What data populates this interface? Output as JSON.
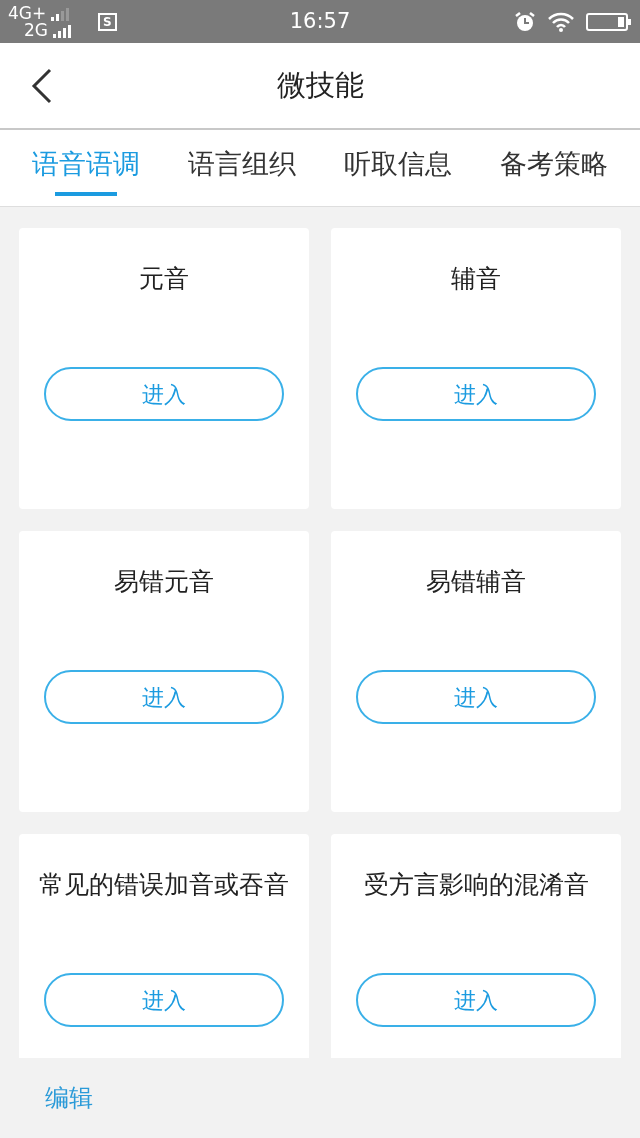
{
  "status_bar": {
    "network_1": "4G+",
    "network_2": "2G",
    "app_badge": "S",
    "time": "16:57"
  },
  "header": {
    "title": "微技能"
  },
  "tabs": [
    {
      "label": "语音语调",
      "selected": true
    },
    {
      "label": "语言组织",
      "selected": false
    },
    {
      "label": "听取信息",
      "selected": false
    },
    {
      "label": "备考策略",
      "selected": false
    }
  ],
  "cards": [
    {
      "title": "元音",
      "button": "进入"
    },
    {
      "title": "辅音",
      "button": "进入"
    },
    {
      "title": "易错元音",
      "button": "进入"
    },
    {
      "title": "易错辅音",
      "button": "进入"
    },
    {
      "title": "常见的错误加音或吞音",
      "button": "进入"
    },
    {
      "title": "受方言影响的混淆音",
      "button": "进入"
    }
  ],
  "footer": {
    "edit": "编辑"
  }
}
